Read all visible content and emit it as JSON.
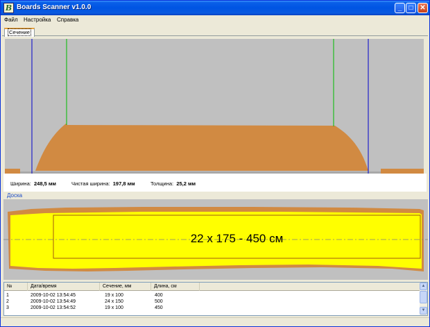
{
  "window": {
    "title": "Boards Scanner v1.0.0",
    "icon_letter": "B"
  },
  "menu": [
    "Файл",
    "Настройка",
    "Справка"
  ],
  "tabs": [
    {
      "label": "Сечение",
      "active": true
    }
  ],
  "measurements": {
    "width_label": "Ширина:",
    "width_value": "248,5 мм",
    "net_width_label": "Чистая ширина:",
    "net_width_value": "197,8 мм",
    "thickness_label": "Толщина:",
    "thickness_value": "25,2 мм"
  },
  "board": {
    "label": "Доска",
    "cut_text": "22 х 175 - 450 см"
  },
  "table": {
    "columns": [
      "№",
      "Дата/время",
      "Сечение, мм",
      "Длина, см"
    ],
    "rows": [
      [
        "1",
        "2009-10-02 13:54:45",
        "19 x 100",
        "400"
      ],
      [
        "2",
        "2009-10-02 13:54:49",
        "24 x 150",
        "500"
      ],
      [
        "3",
        "2009-10-02 13:54:52",
        "19 x 100",
        "450"
      ]
    ]
  },
  "colors": {
    "profile_fill": "#d18a42",
    "board_yellow": "#ffff00",
    "title_blue": "#0054e3",
    "width_line": "#0000cc",
    "net_width_line": "#00bb00"
  }
}
